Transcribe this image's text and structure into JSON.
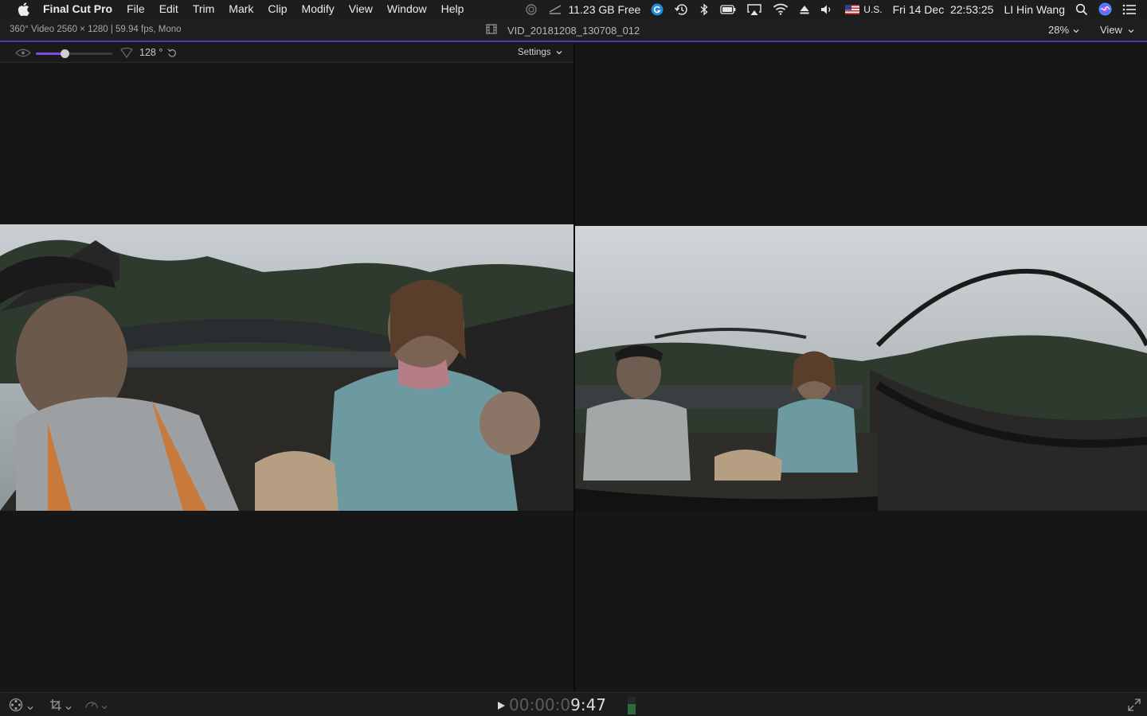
{
  "menubar": {
    "app_name": "Final Cut Pro",
    "items": [
      "File",
      "Edit",
      "Trim",
      "Mark",
      "Clip",
      "Modify",
      "View",
      "Window",
      "Help"
    ],
    "disk_free": "11.23 GB Free",
    "input_source": "U.S.",
    "datetime": "Fri 14 Dec  22:53:25",
    "user": "LI Hin Wang",
    "icons": [
      "apple-icon",
      "activity-icon",
      "disk-icon",
      "grammarly-icon",
      "time-machine-icon",
      "bluetooth-icon",
      "battery-icon",
      "airplay-icon",
      "wifi-icon",
      "eject-icon",
      "volume-icon",
      "flag-icon",
      "search-icon",
      "siri-icon",
      "notification-center-icon"
    ]
  },
  "viewer": {
    "format_info": "360° Video 2560 × 1280 | 59.94 fps, Mono",
    "clip_name": "VID_20181208_130708_012",
    "zoom": "28%",
    "view_menu": "View"
  },
  "controls_360": {
    "field_of_view_fraction": 0.38,
    "angle": "128 °",
    "settings_label": "Settings"
  },
  "playback": {
    "timecode_dim": "00:00:0",
    "timecode_bright": "9:47",
    "audio_level_fraction": 0.6
  },
  "colors": {
    "accent": "#7a4fe0",
    "menubar_bg": "#1d1d1d",
    "viewer_bg": "#161616"
  }
}
